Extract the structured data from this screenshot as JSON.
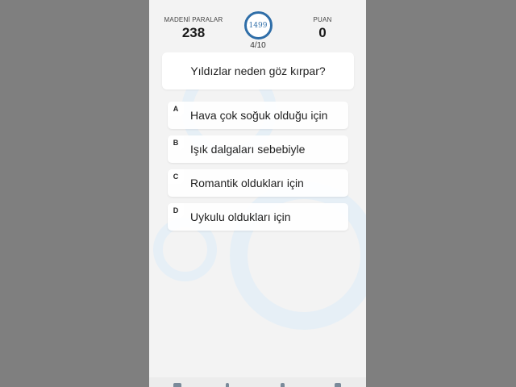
{
  "header": {
    "coins_label": "MADENİ PARALAR",
    "coins_value": "238",
    "timer_value": "1499",
    "progress": "4/10",
    "points_label": "PUAN",
    "points_value": "0"
  },
  "question": {
    "text": "Yıldızlar neden göz kırpar?"
  },
  "answers": [
    {
      "letter": "A",
      "text": "Hava çok soğuk olduğu için"
    },
    {
      "letter": "B",
      "text": "Işık dalgaları sebebiyle"
    },
    {
      "letter": "C",
      "text": "Romantik oldukları için"
    },
    {
      "letter": "D",
      "text": "Uykulu oldukları için"
    }
  ],
  "colors": {
    "timer_ring": "#2f6ea8",
    "background": "#f3f3f3"
  }
}
